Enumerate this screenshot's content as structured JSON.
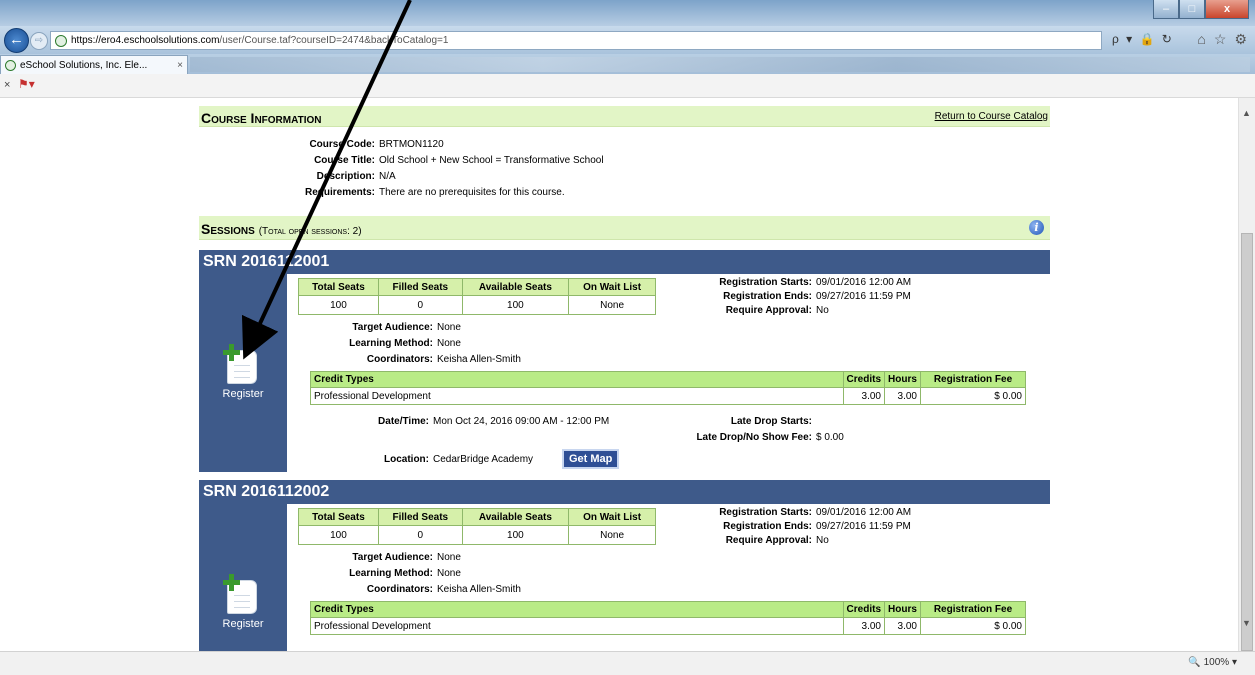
{
  "browser": {
    "url_host": "https://ero4.eschoolsolutions.com",
    "url_path": "/user/Course.taf?courseID=2474&backToCatalog=1",
    "tab_title": "eSchool Solutions, Inc. Ele...",
    "tab_close": "×",
    "cmd_close": "×",
    "zoom": "100%",
    "addr_tools": "ρ ▾ 🔒 ↻",
    "back_glyph": "←",
    "fwd_glyph": "⇨",
    "icon_home": "⌂",
    "icon_star": "☆",
    "icon_gear": "⚙",
    "win_min": "–",
    "win_max": "□",
    "win_close": "x",
    "scroll_up": "▲",
    "scroll_down": "▼"
  },
  "course": {
    "section_title": "Course Information",
    "return_link": "Return to Course Catalog",
    "code_label": "Course Code:",
    "code": "BRTMON1120",
    "title_label": "Course Title:",
    "title": "Old School + New School = Transformative School",
    "desc_label": "Description:",
    "desc": "N/A",
    "req_label": "Requirements:",
    "req": "There are no prerequisites for this course."
  },
  "sessions_header": {
    "title": "Sessions",
    "count_text": "(Total open sessions: 2)",
    "info_icon": "i"
  },
  "labels": {
    "register": "Register",
    "total_seats": "Total Seats",
    "filled_seats": "Filled Seats",
    "available_seats": "Available Seats",
    "on_wait_list": "On Wait List",
    "reg_starts": "Registration Starts:",
    "reg_ends": "Registration Ends:",
    "require_approval": "Require Approval:",
    "target_audience": "Target Audience:",
    "learning_method": "Learning Method:",
    "coordinators": "Coordinators:",
    "credit_types": "Credit Types",
    "credits": "Credits",
    "hours": "Hours",
    "registration_fee": "Registration Fee",
    "datetime": "Date/Time:",
    "late_drop_starts": "Late Drop Starts:",
    "late_drop_fee": "Late Drop/No Show Fee:",
    "location": "Location:",
    "get_map": "Get Map"
  },
  "sessions": [
    {
      "srn": "SRN 2016112001",
      "total_seats": "100",
      "filled_seats": "0",
      "available_seats": "100",
      "wait_list": "None",
      "reg_starts": "09/01/2016 12:00 AM",
      "reg_ends": "09/27/2016 11:59 PM",
      "require_approval": "No",
      "target_audience": "None",
      "learning_method": "None",
      "coordinators": "Keisha Allen-Smith",
      "credit_type": "Professional Development",
      "credits": "3.00",
      "hours": "3.00",
      "fee": "$ 0.00",
      "datetime": "Mon Oct 24, 2016 09:00 AM - 12:00 PM",
      "late_drop_starts": "",
      "late_drop_fee": "$ 0.00",
      "location": "CedarBridge Academy"
    },
    {
      "srn": "SRN 2016112002",
      "total_seats": "100",
      "filled_seats": "0",
      "available_seats": "100",
      "wait_list": "None",
      "reg_starts": "09/01/2016 12:00 AM",
      "reg_ends": "09/27/2016 11:59 PM",
      "require_approval": "No",
      "target_audience": "None",
      "learning_method": "None",
      "coordinators": "Keisha Allen-Smith",
      "credit_type": "Professional Development",
      "credits": "3.00",
      "hours": "3.00",
      "fee": "$ 0.00"
    }
  ]
}
